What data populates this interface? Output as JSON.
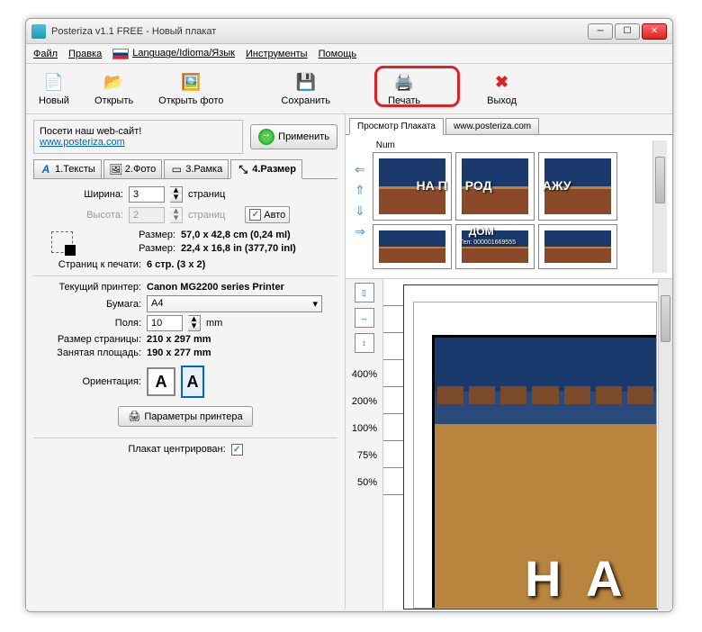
{
  "window": {
    "title": "Posteriza v1.1 FREE - Новый плакат"
  },
  "menu": {
    "file": "Файл",
    "edit": "Правка",
    "lang": "Language/Idioma/Язык",
    "tools": "Инструменты",
    "help": "Помощь"
  },
  "toolbar": {
    "new": "Новый",
    "open": "Открыть",
    "openPhoto": "Открыть фото",
    "save": "Сохранить",
    "print": "Печать",
    "exit": "Выход"
  },
  "website": {
    "label": "Посети наш web-сайт!",
    "url": "www.posteriza.com"
  },
  "apply": "Применить",
  "tabs": {
    "t1": "1.Тексты",
    "t2": "2.Фото",
    "t3": "3.Рамка",
    "t4": "4.Размер"
  },
  "size": {
    "width_label": "Ширина:",
    "width_val": "3",
    "width_unit": "страниц",
    "height_label": "Высота:",
    "height_val": "2",
    "height_unit": "страниц",
    "auto": "Авто",
    "dim1_label": "Размер:",
    "dim1": "57,0 x 42,8 cm (0,24 mI)",
    "dim2_label": "Размер:",
    "dim2": "22,4 x 16,8 in (377,70 inI)",
    "pages_label": "Страниц к печати:",
    "pages": "6 стр. (3 x 2)"
  },
  "printer": {
    "current_label": "Текущий принтер:",
    "current": "Canon MG2200 series Printer",
    "paper_label": "Бумага:",
    "paper": "A4",
    "margin_label": "Поля:",
    "margin": "10",
    "margin_unit": "mm",
    "psize_label": "Размер страницы:",
    "psize": "210 x 297 mm",
    "parea_label": "Занятая площадь:",
    "parea": "190 x 277 mm",
    "orient_label": "Ориентация:",
    "params_btn": "Параметры принтера",
    "centered_label": "Плакат центрирован:"
  },
  "rightTabs": {
    "preview": "Просмотр Плаката",
    "web": "www.posteriza.com"
  },
  "grid_label": "Num",
  "poster_text": {
    "t1": "НА П",
    "t2": "РОД",
    "t3": "АЖУ",
    "t4": "ДОМ",
    "phone": "Тел: 000001669555"
  },
  "zoom": {
    "z1": "400%",
    "z2": "200%",
    "z3": "100%",
    "z4": "75%",
    "z5": "50%"
  },
  "detail_text": "Н А"
}
